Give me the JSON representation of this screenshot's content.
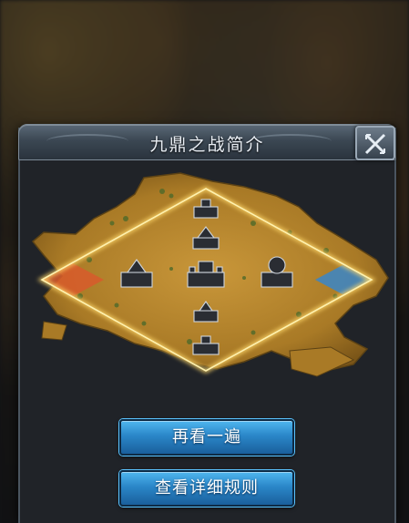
{
  "dialog": {
    "title": "九鼎之战简介"
  },
  "buttons": {
    "replay_label": "再看一遍",
    "rules_label": "查看详细规则"
  },
  "map": {
    "zones": [
      {
        "name": "red-base",
        "color": "#d85a2c"
      },
      {
        "name": "blue-base",
        "color": "#3a86c8"
      }
    ],
    "border_color": "#f5d36a",
    "land_color": "#b8862a"
  },
  "icons": [
    "close-icon",
    "castle-icon"
  ]
}
